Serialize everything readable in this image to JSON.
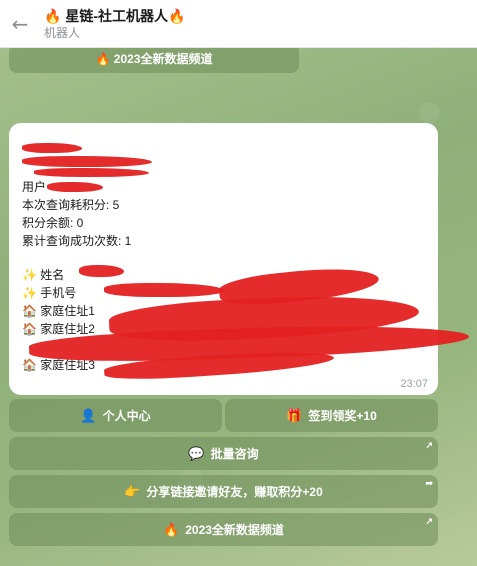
{
  "header": {
    "back_icon": "arrow-left-icon",
    "title": "🔥 星链-社工机器人🔥",
    "subtitle": "机器人"
  },
  "top_button": {
    "label": "🔥 2023全新数据频道"
  },
  "message": {
    "user_label": "用户",
    "lines": [
      "本次查询耗积分: 5",
      "积分余额: 0",
      "累计查询成功次数: 1"
    ],
    "result_items": [
      "✨ 姓名",
      "✨ 手机号",
      "🏠 家庭住址1",
      "🏠 家庭住址2",
      "🏠 家庭住址3"
    ],
    "time": "23:07"
  },
  "keyboard": {
    "profile": {
      "icon": "👤",
      "label": "个人中心"
    },
    "checkin": {
      "icon": "🎁",
      "label": "签到领奖+10"
    },
    "batch": {
      "icon": "💬",
      "label": "批量咨询"
    },
    "share": {
      "icon": "👉",
      "label": "分享链接邀请好友，赚取积分+20"
    },
    "channel": {
      "icon": "🔥",
      "label": "2023全新数据频道"
    }
  }
}
